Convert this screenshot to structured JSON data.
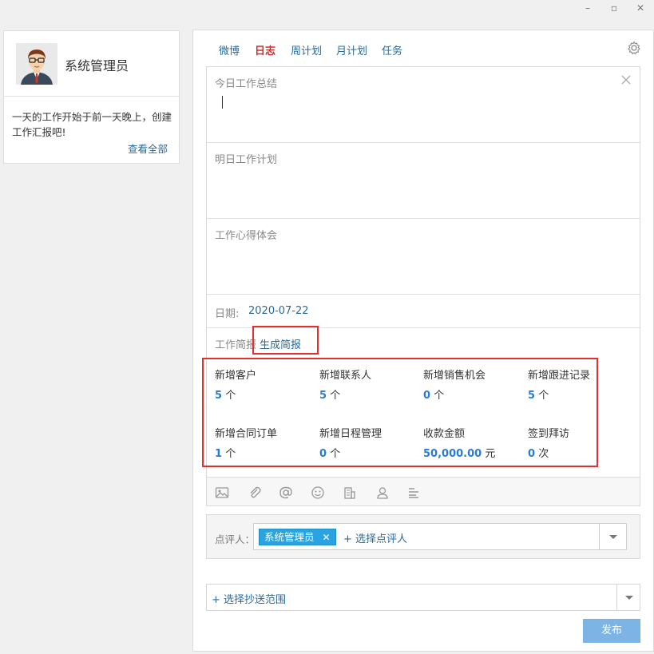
{
  "window": {
    "minimize_glyph": "–",
    "maximize_glyph": "▫",
    "close_glyph": "✕"
  },
  "profile": {
    "name": "系统管理员",
    "tip": "一天的工作开始于前一天晚上，创建工作汇报吧!",
    "view_all": "查看全部"
  },
  "tabs": [
    {
      "label": "微博",
      "active": false
    },
    {
      "label": "日志",
      "active": true
    },
    {
      "label": "周计划",
      "active": false
    },
    {
      "label": "月计划",
      "active": false
    },
    {
      "label": "任务",
      "active": false
    }
  ],
  "editor": {
    "today_summary": "今日工作总结",
    "tomorrow_plan": "明日工作计划",
    "experience": "工作心得体会",
    "date_label": "日期:",
    "date_value": "2020-07-22",
    "brief_label": "工作简报",
    "generate_brief": "生成简报"
  },
  "stats": [
    {
      "name": "新增客户",
      "value": "5",
      "unit": "个"
    },
    {
      "name": "新增联系人",
      "value": "5",
      "unit": "个"
    },
    {
      "name": "新增销售机会",
      "value": "0",
      "unit": "个"
    },
    {
      "name": "新增跟进记录",
      "value": "5",
      "unit": "个"
    },
    {
      "name": "新增合同订单",
      "value": "1",
      "unit": "个"
    },
    {
      "name": "新增日程管理",
      "value": "0",
      "unit": "个"
    },
    {
      "name": "收款金额",
      "value": "50,000.00",
      "unit": "元"
    },
    {
      "name": "签到拜访",
      "value": "0",
      "unit": "次"
    }
  ],
  "toolbar_icons": [
    "image-icon",
    "attachment-icon",
    "mention-icon",
    "emoji-icon",
    "building-icon",
    "user-icon",
    "list-icon"
  ],
  "reviewer": {
    "label": "点评人：",
    "chip": "系统管理员",
    "add": "+ 选择点评人"
  },
  "cc": {
    "add": "+ 选择抄送范围"
  },
  "publish": "发布",
  "colors": {
    "accent": "#2b6a98",
    "active_tab": "#c9302c",
    "value_blue": "#2b7bd0",
    "highlight_red": "#e03030",
    "chip_bg": "#2aa3e0",
    "publish_bg": "#7cb4e6"
  }
}
